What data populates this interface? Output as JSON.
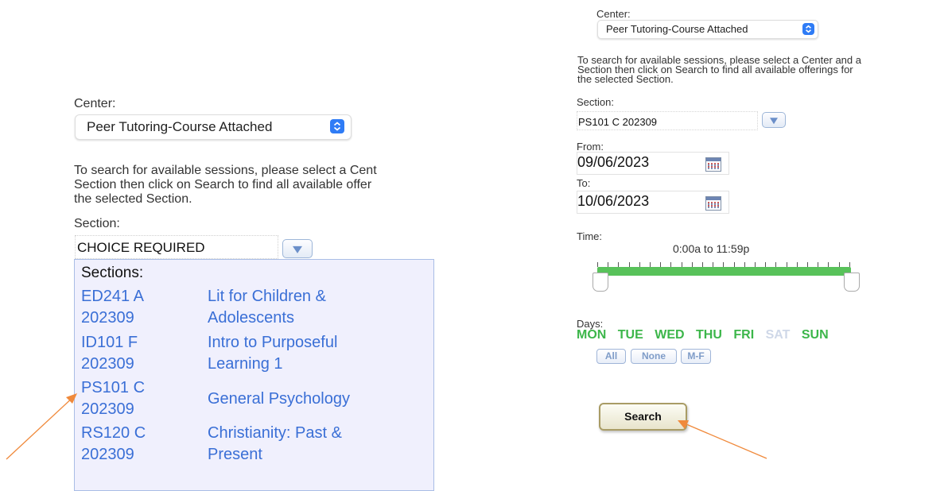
{
  "left_panel": {
    "center_label": "Center:",
    "center_value": "Peer Tutoring-Course Attached",
    "instructions": [
      "To search for available sessions, please select a Cent",
      "Section then click on Search to find all available offer",
      "the selected Section."
    ],
    "section_label": "Section:",
    "section_value": "CHOICE REQUIRED",
    "list_header": "Sections:",
    "sections": [
      {
        "code": [
          "ED241 A",
          "202309"
        ],
        "name": [
          "Lit for Children &",
          "Adolescents"
        ]
      },
      {
        "code": [
          "ID101 F",
          "202309"
        ],
        "name": [
          "Intro to Purposeful",
          "Learning 1"
        ]
      },
      {
        "code": [
          "PS101 C",
          "202309"
        ],
        "name": [
          "General Psychology"
        ]
      },
      {
        "code": [
          "RS120 C",
          "202309"
        ],
        "name": [
          "Christianity: Past &",
          "Present"
        ]
      }
    ]
  },
  "right_panel": {
    "center_label": "Center:",
    "center_value": "Peer Tutoring-Course Attached",
    "instructions": [
      "To search for available sessions, please select a Center and a",
      "Section then click on Search to find all available offerings for",
      "the selected Section."
    ],
    "section_label": "Section:",
    "section_value": "PS101 C 202309",
    "from_label": "From:",
    "from_value": "09/06/2023",
    "to_label": "To:",
    "to_value": "10/06/2023",
    "time_label": "Time:",
    "time_range": "0:00a to 11:59p",
    "days_label": "Days:",
    "days": [
      {
        "label": "MON",
        "selected": true
      },
      {
        "label": "TUE",
        "selected": true
      },
      {
        "label": "WED",
        "selected": true
      },
      {
        "label": "THU",
        "selected": true
      },
      {
        "label": "FRI",
        "selected": true
      },
      {
        "label": "SAT",
        "selected": false
      },
      {
        "label": "SUN",
        "selected": true
      }
    ],
    "day_buttons": {
      "all": "All",
      "none": "None",
      "mf": "M-F"
    },
    "search_label": "Search"
  },
  "colors": {
    "link_blue": "#3a6fd6",
    "day_selected": "#3cb64a",
    "day_unselected": "#cfd8e8",
    "slider_green": "#58c25a",
    "annotation_arrow": "#f08a3c"
  }
}
